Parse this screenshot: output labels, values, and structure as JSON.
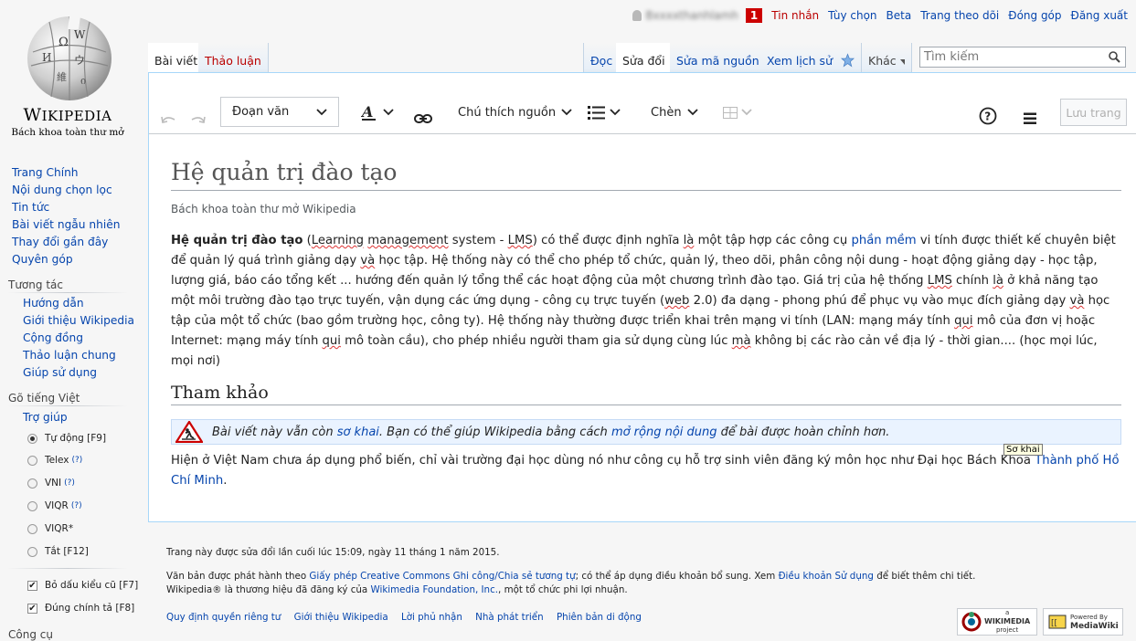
{
  "logo": {
    "wordmark_big": "W",
    "wordmark_rest": "IKIPEDIA",
    "tagline": "Bách khoa toàn thư mở"
  },
  "personal": {
    "username": "Bxxxxthanhlamh",
    "notification_count": "1",
    "items": [
      "Tin nhắn",
      "Tùy chọn",
      "Beta",
      "Trang theo dõi",
      "Đóng góp",
      "Đăng xuất"
    ]
  },
  "tabs": {
    "left": [
      "Bài viết",
      "Thảo luận"
    ],
    "right": [
      "Đọc",
      "Sửa đổi",
      "Sửa mã nguồn",
      "Xem lịch sử"
    ],
    "more": "Khác"
  },
  "search": {
    "placeholder": "Tìm kiếm"
  },
  "toolbar": {
    "paragraph": "Đoạn văn",
    "cite": "Chú thích nguồn",
    "insert": "Chèn",
    "save": "Lưu trang"
  },
  "article": {
    "title": "Hệ quản trị đào tạo",
    "tagline": "Bách khoa toàn thư mở Wikipedia",
    "body": {
      "bold": "Hệ quản trị đào tạo",
      "p1": " (",
      "w1": "Learning",
      "p2": " ",
      "w2": "management",
      "p3": " system - ",
      "w3": "LMS",
      "p4": ") có thể được định nghĩa ",
      "w4": "là",
      "p5": " một tập hợp các công cụ ",
      "link1": "phần mềm",
      "p6": " vi tính được thiết kế chuyên biệt để quản lý quá trình giảng dạy ",
      "w5": "và",
      "p7": " học tập. Hệ thống này có thể cho phép tổ chức, quản lý, theo dõi, phân công nội dung - hoạt động giảng dạy - học tập, lượng giá, báo cáo tổng kết ... hướng đến quản lý tổng thể các hoạt động của một chương trình đào tạo. Giá trị của hệ thống ",
      "w6": "LMS",
      "p8": " chính ",
      "w7": "là",
      "p9": " ở khả năng tạo một môi trường đào tạo trực tuyến, vận dụng các ứng dụng - công cụ trực tuyến (",
      "w8": "web",
      "p10": " 2.0) đa dạng - phong phú để phục vụ vào mục đích giảng dạy ",
      "w9": "và",
      "p11": " học tập của một tổ chức (bao gồm trường học, công ty). Hệ thống này thường được triển khai trên mạng vi tính (LAN: mạng máy tính ",
      "w10": "qui",
      "p12": " mô của đơn vị hoặc Internet: mạng máy tính ",
      "w11": "qui",
      "p13": " mô toàn cầu), cho phép nhiều người tham gia sử dụng cùng lúc ",
      "w12": "mà",
      "p14": " không bị các rào cản về địa lý - thời gian.... (học mọi lúc, mọi nơi)"
    },
    "ref_heading": "Tham khảo",
    "stub": {
      "t1": "Bài viết này vẫn còn ",
      "l1": "sơ khai",
      "t2": ". Bạn có thể giúp Wikipedia bằng cách ",
      "l2": "mở rộng nội dung",
      "t3": " để bài được hoàn chỉnh hơn."
    },
    "after": {
      "t1": "Hiện ở Việt Nam chưa áp dụng phổ biến, chỉ vài trường đại học dùng nó như công cụ hỗ trợ sinh viên đăng ký môn học như Đại học Bách Khoa ",
      "l1": "Thành phố Hồ Chí Minh",
      "t2": "."
    },
    "tooltip": "Sơ khai"
  },
  "sidebar": {
    "main": [
      "Trang Chính",
      "Nội dung chọn lọc",
      "Tin tức",
      "Bài viết ngẫu nhiên",
      "Thay đổi gần đây",
      "Quyên góp"
    ],
    "interaction_head": "Tương tác",
    "interaction": [
      "Hướng dẫn",
      "Giới thiệu Wikipedia",
      "Cộng đồng",
      "Thảo luận chung",
      "Giúp sử dụng"
    ],
    "typing_head": "Gõ tiếng Việt",
    "typing_help": "Trợ giúp",
    "modes": [
      {
        "label": "Tự động",
        "key": "[F9]",
        "help": ""
      },
      {
        "label": "Telex",
        "key": "",
        "help": "(?)"
      },
      {
        "label": "VNI",
        "key": "",
        "help": "(?)"
      },
      {
        "label": "VIQR",
        "key": "",
        "help": "(?)"
      },
      {
        "label": "VIQR*",
        "key": "",
        "help": ""
      },
      {
        "label": "Tắt",
        "key": "[F12]",
        "help": ""
      }
    ],
    "checks": [
      {
        "label": "Bỏ dấu kiểu cũ",
        "key": "[F7]"
      },
      {
        "label": "Đúng chính tả",
        "key": "[F8]"
      }
    ],
    "tools_head": "Công cụ"
  },
  "footer": {
    "last_mod": "Trang này được sửa đổi lần cuối lúc 15:09, ngày 11 tháng 1 năm 2015.",
    "lic1": "Văn bản được phát hành theo ",
    "lic_link": "Giấy phép Creative Commons Ghi công/Chia sẻ tương tự",
    "lic2": "; có thể áp dụng điều khoản bổ sung. Xem ",
    "terms_link": "Điều khoản Sử dụng",
    "lic3": " để biết thêm chi tiết.",
    "tm1": "Wikipedia® là thương hiệu đã đăng ký của ",
    "tm_link": "Wikimedia Foundation, Inc.",
    "tm2": ", một tổ chức phi lợi nhuận.",
    "links": [
      "Quy định quyền riêng tư",
      "Giới thiệu Wikipedia",
      "Lời phủ nhận",
      "Nhà phát triển",
      "Phiên bản di động"
    ],
    "wm_badge_small": "a",
    "wm_badge": "WIKIMEDIA",
    "wm_badge_sub": "project",
    "mw_badge_small": "Powered By",
    "mw_badge": "MediaWiki"
  }
}
